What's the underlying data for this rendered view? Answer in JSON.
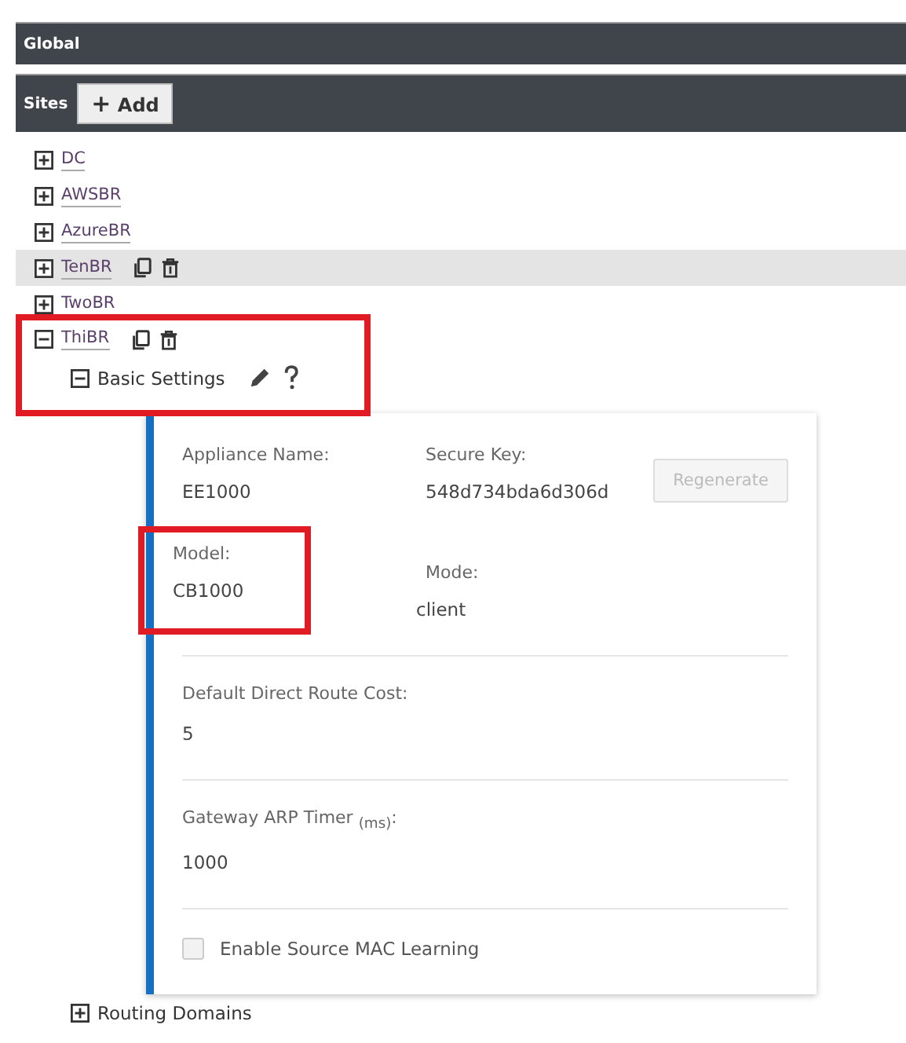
{
  "header": {
    "title": "Global"
  },
  "sites_bar": {
    "label": "Sites",
    "add_button": {
      "icon": "+",
      "label": "Add"
    }
  },
  "sites": [
    {
      "name": "DC",
      "expanded": false,
      "selected": false,
      "show_actions": false
    },
    {
      "name": "AWSBR",
      "expanded": false,
      "selected": false,
      "show_actions": false
    },
    {
      "name": "AzureBR",
      "expanded": false,
      "selected": false,
      "show_actions": false
    },
    {
      "name": "TenBR",
      "expanded": false,
      "selected": true,
      "show_actions": true
    },
    {
      "name": "TwoBR",
      "expanded": false,
      "selected": false,
      "show_actions": false
    },
    {
      "name": "ThiBR",
      "expanded": true,
      "selected": false,
      "show_actions": true,
      "children": [
        {
          "name": "Basic Settings",
          "expanded": true,
          "kind": "settings"
        },
        {
          "name": "Routing Domains",
          "expanded": false,
          "kind": "plain"
        }
      ]
    }
  ],
  "settings_panel": {
    "appliance_name": {
      "label": "Appliance Name:",
      "value": "EE1000"
    },
    "secure_key": {
      "label": "Secure Key:",
      "value": "548d734bda6d306d"
    },
    "regenerate_button": {
      "label": "Regenerate",
      "disabled": true
    },
    "model": {
      "label": "Model:",
      "value": "CB1000"
    },
    "mode": {
      "label": "Mode:",
      "value": "client"
    },
    "route_cost": {
      "label": "Default Direct Route Cost:",
      "value": "5"
    },
    "arp_timer": {
      "label": "Gateway ARP Timer $_{(ms)}$:",
      "value": "1000"
    },
    "source_mac_learning": {
      "label": "Enable Source MAC Learning",
      "checked": false
    }
  }
}
